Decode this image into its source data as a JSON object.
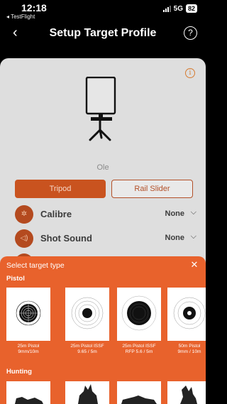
{
  "status": {
    "time": "12:18",
    "back_app": "◂ TestFlight",
    "network": "5G",
    "battery": "82"
  },
  "nav": {
    "title": "Setup Target Profile",
    "back_glyph": "‹",
    "help_glyph": "?"
  },
  "profile": {
    "name": "Ole",
    "mounts": [
      "Tripod",
      "Rail Slider"
    ],
    "selected_mount": "Tripod"
  },
  "settings": [
    {
      "label": "Calibre",
      "value": "None",
      "icon": "calibre-icon"
    },
    {
      "label": "Shot Sound",
      "value": "None",
      "icon": "sound-icon"
    }
  ],
  "picker": {
    "title": "Select target type",
    "close_glyph": "✕",
    "sections": {
      "pistol": "Pistol",
      "hunting": "Hunting"
    },
    "pistol_targets": [
      {
        "line1": "25m Pistol",
        "line2": "9mm/10m"
      },
      {
        "line1": "25m Pistol ISSF",
        "line2": "9.65 / 5m"
      },
      {
        "line1": "25m Pistol ISSF",
        "line2": "RFP 5.6 / 5m"
      },
      {
        "line1": "50m Pistol",
        "line2": "9mm / 10m"
      }
    ]
  },
  "colors": {
    "accent": "#e8622c",
    "button_selected": "#c9531f",
    "sheet_dim": "#dedede"
  }
}
